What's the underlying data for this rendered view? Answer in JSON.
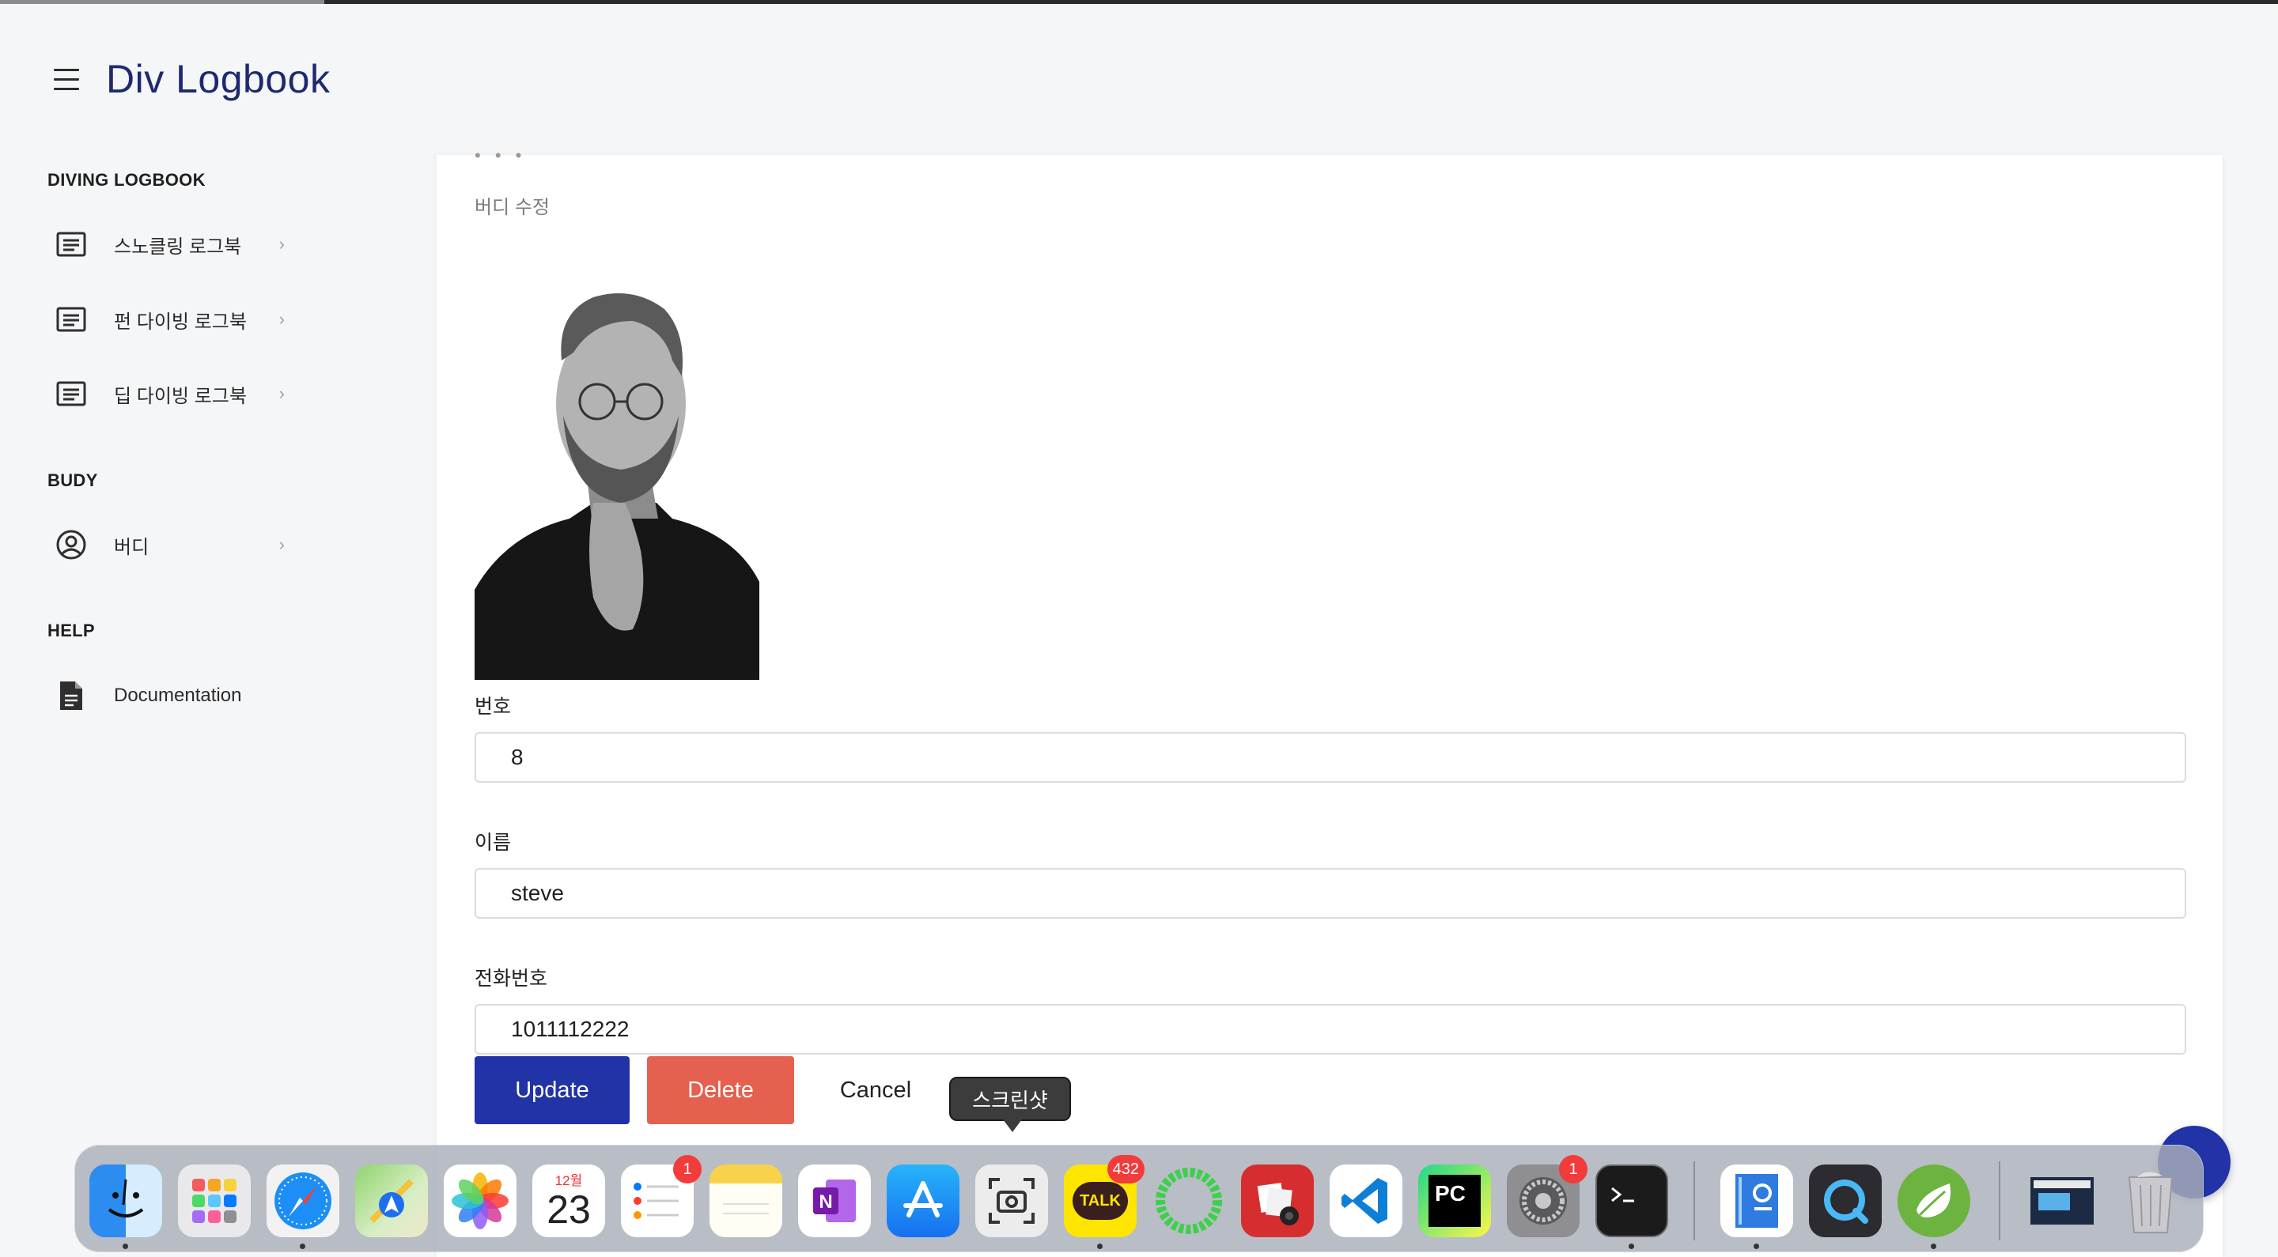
{
  "app": {
    "title": "Div Logbook"
  },
  "sidebar": {
    "sections": [
      {
        "title": "DIVING LOGBOOK",
        "items": [
          {
            "label": "스노클링 로그북",
            "icon": "list-alt-icon"
          },
          {
            "label": "펀 다이빙 로그북",
            "icon": "list-alt-icon"
          },
          {
            "label": "딥 다이빙 로그북",
            "icon": "list-alt-icon"
          }
        ]
      },
      {
        "title": "BUDY",
        "items": [
          {
            "label": "버디",
            "icon": "account-circle-icon"
          }
        ]
      },
      {
        "title": "HELP",
        "items": [
          {
            "label": "Documentation",
            "icon": "document-icon"
          }
        ]
      }
    ]
  },
  "main": {
    "top_text": "• • •",
    "subtitle": "버디 수정",
    "photo_alt": "",
    "fields": [
      {
        "label": "번호",
        "value": "8"
      },
      {
        "label": "이름",
        "value": "steve"
      },
      {
        "label": "전화번호",
        "value": "1011112222"
      }
    ],
    "buttons": {
      "update": "Update",
      "delete": "Delete",
      "cancel": "Cancel"
    }
  },
  "tooltip": {
    "text": "스크린샷"
  },
  "dock": {
    "calendar": {
      "month": "12월",
      "day": "23"
    },
    "apps": [
      {
        "name": "Finder",
        "icon": "finder-icon",
        "running": true
      },
      {
        "name": "Launchpad",
        "icon": "launchpad-icon",
        "running": false
      },
      {
        "name": "Safari",
        "icon": "safari-icon",
        "running": true
      },
      {
        "name": "Maps",
        "icon": "maps-icon",
        "running": false
      },
      {
        "name": "Photos",
        "icon": "photos-icon",
        "running": false
      },
      {
        "name": "Calendar",
        "icon": "calendar-icon",
        "running": false
      },
      {
        "name": "Reminders",
        "icon": "reminders-icon",
        "running": false,
        "badge": "1"
      },
      {
        "name": "Notes",
        "icon": "notes-icon",
        "running": false
      },
      {
        "name": "OneNote",
        "icon": "onenote-icon",
        "running": false
      },
      {
        "name": "App Store",
        "icon": "app-store-icon",
        "running": false
      },
      {
        "name": "Screenshot",
        "icon": "screenshot-icon",
        "running": false
      },
      {
        "name": "KakaoTalk",
        "icon": "kakaotalk-icon",
        "running": true,
        "badge": "432",
        "label": "TALK"
      },
      {
        "name": "Ring",
        "icon": "green-ring-icon",
        "running": false
      },
      {
        "name": "Photo Booth",
        "icon": "photo-booth-icon",
        "running": false
      },
      {
        "name": "VS Code",
        "icon": "vscode-icon",
        "running": false
      },
      {
        "name": "PyCharm",
        "icon": "pycharm-icon",
        "running": false,
        "label": "PC"
      },
      {
        "name": "System Settings",
        "icon": "settings-icon",
        "running": false,
        "badge": "1"
      },
      {
        "name": "Terminal",
        "icon": "terminal-icon",
        "running": true
      },
      {
        "name": "Hangul",
        "icon": "hangul-icon",
        "running": true
      },
      {
        "name": "QuickTime",
        "icon": "quicktime-icon",
        "running": false
      },
      {
        "name": "Spring",
        "icon": "spring-icon",
        "running": true
      },
      {
        "name": "Screenshot Folder",
        "icon": "screenshot-folder-icon",
        "running": false
      },
      {
        "name": "Trash",
        "icon": "trash-icon",
        "running": false
      }
    ]
  },
  "colors": {
    "title": "#1e2a6e",
    "primary": "#2133a6",
    "danger": "#e5604f",
    "badge": "#f23b3b"
  }
}
